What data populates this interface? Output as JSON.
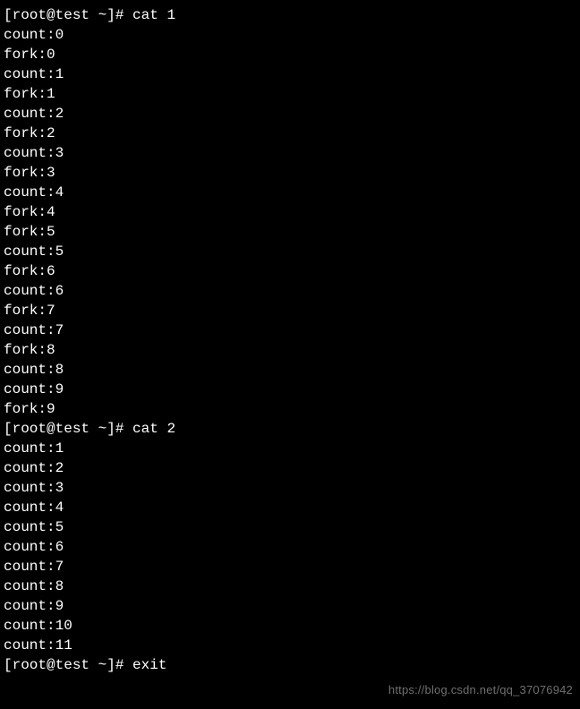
{
  "terminal": {
    "prompt": "[root@test ~]# ",
    "blocks": [
      {
        "command": "cat 1",
        "output": [
          "count:0",
          "fork:0",
          "count:1",
          "fork:1",
          "count:2",
          "fork:2",
          "count:3",
          "fork:3",
          "count:4",
          "fork:4",
          "fork:5",
          "count:5",
          "fork:6",
          "count:6",
          "fork:7",
          "count:7",
          "fork:8",
          "count:8",
          "count:9",
          "fork:9"
        ]
      },
      {
        "command": "cat 2",
        "output": [
          "count:1",
          "count:2",
          "count:3",
          "count:4",
          "count:5",
          "count:6",
          "count:7",
          "count:8",
          "count:9",
          "count:10",
          "count:11"
        ]
      },
      {
        "command": "exit",
        "output": []
      }
    ]
  },
  "watermark": "https://blog.csdn.net/qq_37076942"
}
